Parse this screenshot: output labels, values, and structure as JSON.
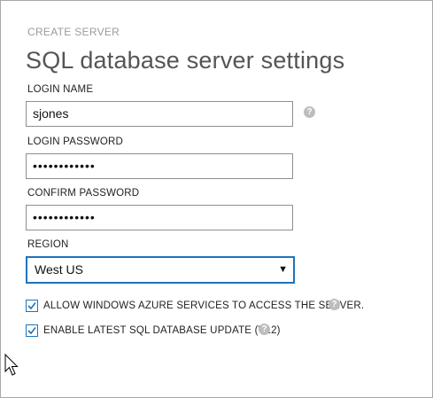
{
  "header": {
    "eyebrow": "CREATE SERVER",
    "title": "SQL database server settings"
  },
  "login_name": {
    "label": "LOGIN NAME",
    "value": "sjones",
    "help_icon": "question-circle-icon"
  },
  "login_password": {
    "label": "LOGIN PASSWORD",
    "value": "••••••••••••"
  },
  "confirm_password": {
    "label": "CONFIRM PASSWORD",
    "value": "••••••••••••"
  },
  "region": {
    "label": "REGION",
    "selected": "West US",
    "arrow": "▼"
  },
  "options": [
    {
      "label": "ALLOW WINDOWS AZURE SERVICES TO ACCESS THE SERVER.",
      "checked": true
    },
    {
      "label": "ENABLE LATEST SQL DATABASE UPDATE (V12)",
      "checked": true
    }
  ],
  "help_glyph": "?",
  "colors": {
    "accent": "#1e73be",
    "help_icon": "#bdbdbd",
    "muted_text": "#9b9b9b"
  }
}
